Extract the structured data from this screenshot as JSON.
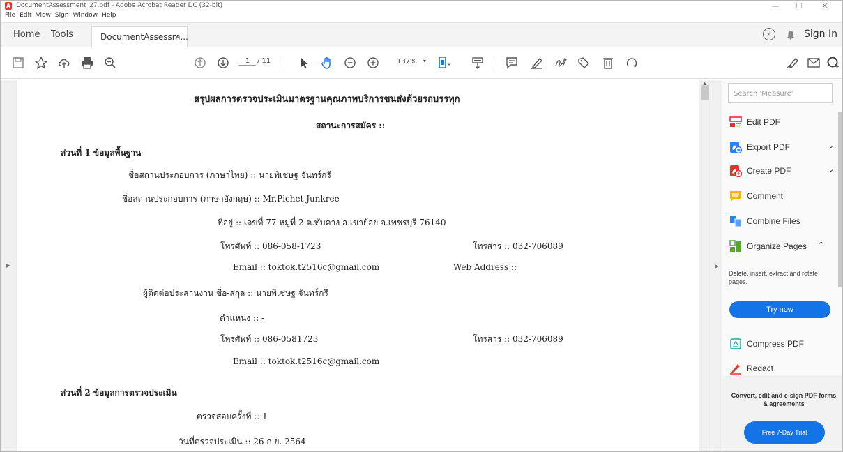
{
  "window": {
    "title": "DocumentAssessment_27.pdf - Adobe Acrobat Reader DC (32-bit)",
    "controls": [
      "—",
      "☐",
      "✕"
    ]
  },
  "menu": [
    "File",
    "Edit",
    "View",
    "Sign",
    "Window",
    "Help"
  ],
  "tabs": {
    "home": "Home",
    "tools": "Tools",
    "document": "DocumentAssessm...",
    "close": "×",
    "sign_in": "Sign In",
    "help": "?"
  },
  "toolbar": {
    "page_current": "1",
    "page_total": "/ 11",
    "zoom": "137%",
    "zoom_dropdown": "▾"
  },
  "document": {
    "title": "สรุปผลการตรวจประเมินมาตรฐานคุณภาพบริการขนส่งด้วยรถบรรทุก",
    "status": "สถานะการสมัคร ::",
    "section1": "ส่วนที่ 1 ข้อมูลพื้นฐาน",
    "name_th": "ชื่อสถานประกอบการ (ภาษาไทย) :: นายพิเชษฐ จันทร์กรี",
    "name_en": "ชื่อสถานประกอบการ (ภาษาอังกฤษ) :: Mr.Pichet  Junkree",
    "address": "ที่อยู่ :: เลขที่ 77 หมู่ที่ 2 ต.ทับคาง อ.เขาย้อย จ.เพชรบุรี 76140",
    "phone1": "โทรศัพท์ :: 086-058-1723",
    "fax1": "โทรสาร :: 032-706089",
    "email1": "Email :: toktok.t2516c@gmail.com",
    "web": "Web Address ::",
    "contact": "ผู้ติดต่อประสานงาน ชื่อ-สกุล :: นายพิเชษฐ  จันทร์กรี",
    "position": "ตำแหน่ง :: -",
    "phone2": "โทรศัพท์ :: 086-0581723",
    "fax2": "โทรสาร :: 032-706089",
    "email2": "Email :: toktok.t2516c@gmail.com",
    "section2": "ส่วนที่ 2 ข้อมูลการตรวจประเมิน",
    "inspection_no": "ตรวจสอบครั้งที่ :: 1",
    "inspection_date": "วันที่ตรวจประเมิน :: 26 ก.ย. 2564"
  },
  "right_panel": {
    "search_placeholder": "Search 'Measure'",
    "tools": [
      {
        "label": "Edit PDF",
        "icon": "edit-pdf-icon",
        "color": "#e2352c"
      },
      {
        "label": "Export PDF",
        "icon": "export-pdf-icon",
        "color": "#2d7ff9",
        "chevron": "⌄"
      },
      {
        "label": "Create PDF",
        "icon": "create-pdf-icon",
        "color": "#e2352c",
        "chevron": "⌄"
      },
      {
        "label": "Comment",
        "icon": "comment-icon",
        "color": "#f5b800"
      },
      {
        "label": "Combine Files",
        "icon": "combine-files-icon",
        "color": "#2d7ff9"
      },
      {
        "label": "Organize Pages",
        "icon": "organize-pages-icon",
        "color": "#52a82c",
        "chevron": "^"
      }
    ],
    "organize_desc": "Delete, insert, extract and rotate pages.",
    "try_now": "Try now",
    "more_tools": [
      {
        "label": "Compress PDF",
        "icon": "compress-pdf-icon",
        "color": "#23a5a5"
      },
      {
        "label": "Redact",
        "icon": "redact-icon",
        "color": "#e2352c"
      }
    ],
    "promo_text": "Convert, edit and e-sign PDF forms & agreements",
    "trial_button": "Free 7-Day Trial"
  },
  "colors": {
    "accent": "#1473e6",
    "adobe_red": "#e2352c"
  }
}
